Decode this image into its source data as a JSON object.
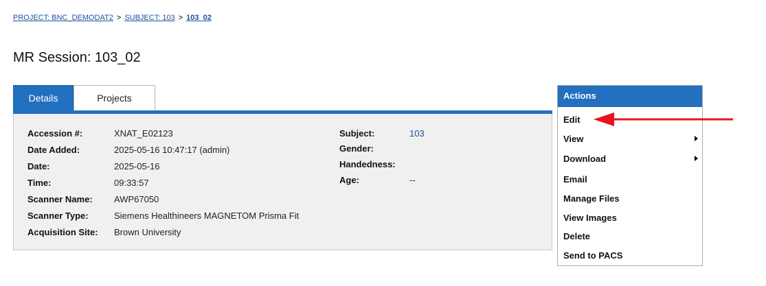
{
  "breadcrumb": {
    "project": "PROJECT: BNC_DEMODAT2",
    "sep1": ">",
    "subject": "SUBJECT: 103",
    "sep2": ">",
    "current": "103_02"
  },
  "page_title": "MR Session: 103_02",
  "tabs": [
    {
      "label": "Details",
      "active": true
    },
    {
      "label": "Projects",
      "active": false
    }
  ],
  "details": {
    "left": [
      {
        "label": "Accession #:",
        "value": "XNAT_E02123"
      },
      {
        "label": "Date Added:",
        "value": "2025-05-16 10:47:17 (admin)"
      },
      {
        "label": "Date:",
        "value": "2025-05-16"
      },
      {
        "label": "Time:",
        "value": "09:33:57"
      },
      {
        "label": "Scanner Name:",
        "value": "AWP67050"
      },
      {
        "label": "Scanner Type:",
        "value": "Siemens Healthineers MAGNETOM Prisma Fit"
      },
      {
        "label": "Acquisition Site:",
        "value": "Brown University"
      }
    ],
    "right": [
      {
        "label": "Subject:",
        "value": "103"
      },
      {
        "label": "Gender:",
        "value": ""
      },
      {
        "label": "Handedness:",
        "value": ""
      },
      {
        "label": "Age:",
        "value": "--"
      }
    ]
  },
  "actions": {
    "title": "Actions",
    "items": [
      {
        "label": "Edit",
        "submenu": false
      },
      {
        "label": "View",
        "submenu": true
      },
      {
        "label": "Download",
        "submenu": true
      },
      {
        "label": "Email",
        "submenu": false
      },
      {
        "label": "Manage Files",
        "submenu": false
      },
      {
        "label": "View Images",
        "submenu": false
      },
      {
        "label": "Delete",
        "submenu": false
      },
      {
        "label": "Send to PACS",
        "submenu": false
      }
    ]
  },
  "colors": {
    "accent": "#2270bf",
    "link": "#1a4f9c",
    "annotation_arrow": "#e8141b"
  },
  "annotation": {
    "icon": "red-arrow-icon"
  }
}
